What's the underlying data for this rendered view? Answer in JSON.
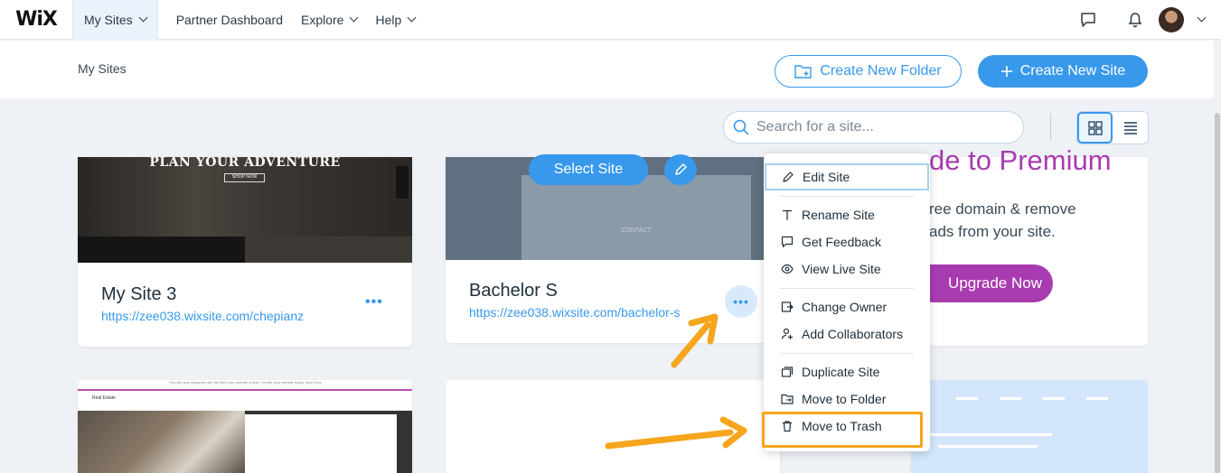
{
  "topnav": {
    "logo": "WiX",
    "items": [
      {
        "label": "My Sites",
        "dropdown": true
      },
      {
        "label": "Partner Dashboard",
        "dropdown": false
      },
      {
        "label": "Explore",
        "dropdown": true
      },
      {
        "label": "Help",
        "dropdown": true
      }
    ]
  },
  "header": {
    "breadcrumb": "My Sites",
    "create_folder_label": "Create New Folder",
    "create_site_label": "Create New Site"
  },
  "search": {
    "placeholder": "Search for a site..."
  },
  "sites": [
    {
      "name": "My Site 3",
      "url": "https://zee038.wixsite.com/chepianz",
      "thumb_headline": "PLAN YOUR ADVENTURE",
      "thumb_button": "SHOP NOW"
    },
    {
      "name": "Bachelor S",
      "url": "https://zee038.wixsite.com/bachelor-s",
      "thumb_text": "CONTACT",
      "select_label": "Select Site"
    }
  ],
  "premium": {
    "title": "de to Premium",
    "line1": "ree domain & remove",
    "line2": "ads from your site.",
    "button": "Upgrade Now"
  },
  "thumb4": {
    "banner": "This site was designed with the WIX.com website builder. Create your website today. Start Now",
    "title": "Real Estate"
  },
  "context_menu": {
    "items": {
      "edit": "Edit Site",
      "rename": "Rename Site",
      "feedback": "Get Feedback",
      "view": "View Live Site",
      "owner": "Change Owner",
      "collab": "Add Collaborators",
      "duplicate": "Duplicate Site",
      "move_folder": "Move to Folder",
      "trash": "Move to Trash"
    }
  },
  "colors": {
    "accent": "#3899ec",
    "premium": "#a83bb0",
    "annotation": "#f6a51d"
  }
}
